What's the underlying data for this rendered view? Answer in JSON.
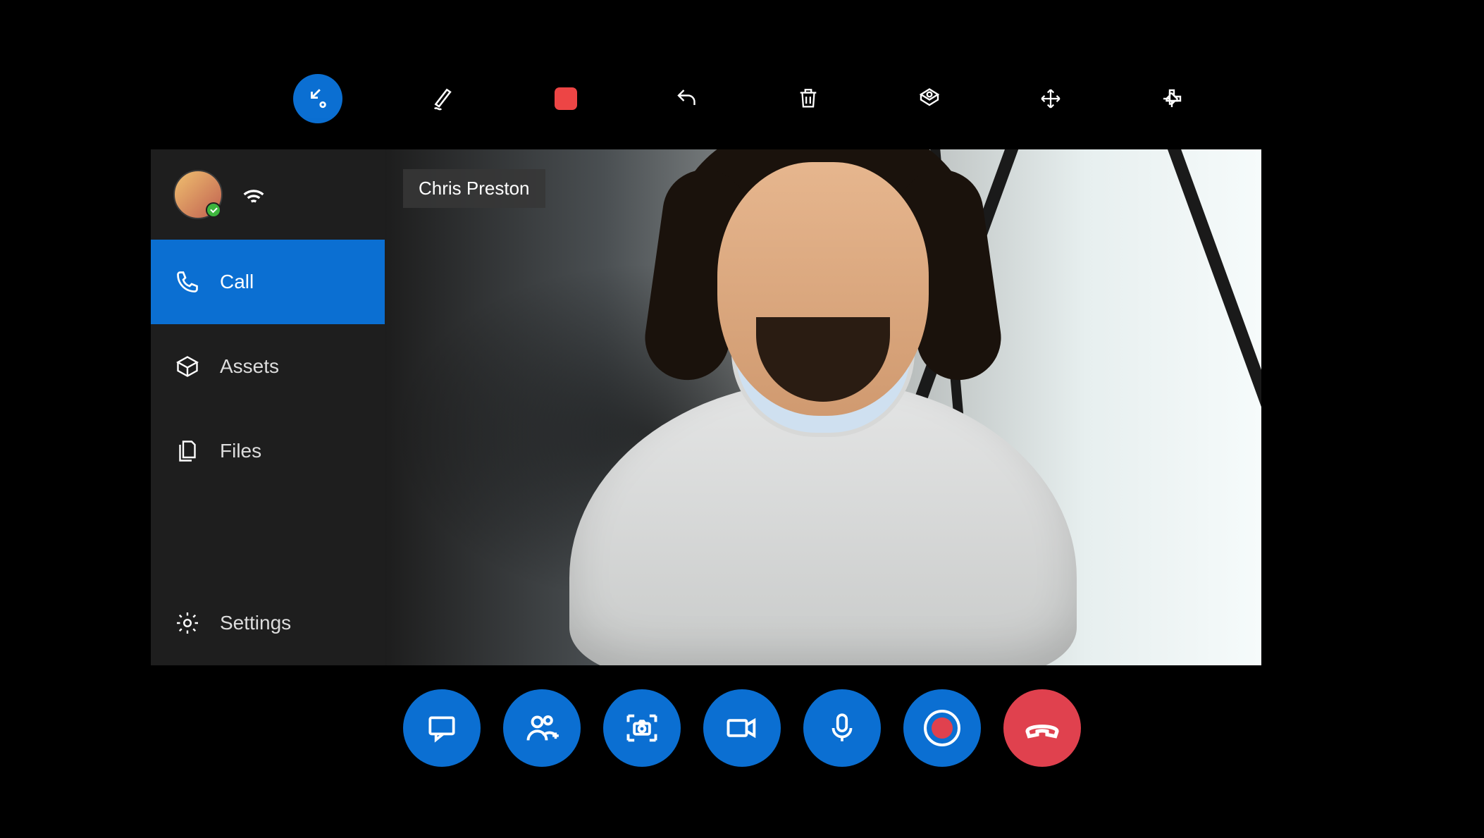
{
  "participant": {
    "name": "Chris Preston"
  },
  "sidebar": {
    "items": [
      {
        "label": "Call",
        "icon": "phone-icon",
        "selected": true
      },
      {
        "label": "Assets",
        "icon": "assets-icon",
        "selected": false
      },
      {
        "label": "Files",
        "icon": "files-icon",
        "selected": false
      }
    ],
    "footer": {
      "label": "Settings",
      "icon": "settings-icon"
    }
  },
  "top_toolbar": {
    "items": [
      {
        "name": "collapse-icon",
        "active": true
      },
      {
        "name": "ink-icon"
      },
      {
        "name": "stop-icon"
      },
      {
        "name": "undo-icon"
      },
      {
        "name": "delete-icon"
      },
      {
        "name": "place-icon"
      },
      {
        "name": "move-icon"
      },
      {
        "name": "pin-icon"
      }
    ]
  },
  "call_bar": {
    "items": [
      {
        "name": "chat-button"
      },
      {
        "name": "add-participant-button"
      },
      {
        "name": "snapshot-button"
      },
      {
        "name": "video-toggle-button"
      },
      {
        "name": "mic-toggle-button"
      },
      {
        "name": "record-button"
      },
      {
        "name": "hangup-button"
      }
    ]
  },
  "colors": {
    "accent": "#0b6fd2",
    "danger": "#e0414e",
    "record": "#ed4545"
  }
}
